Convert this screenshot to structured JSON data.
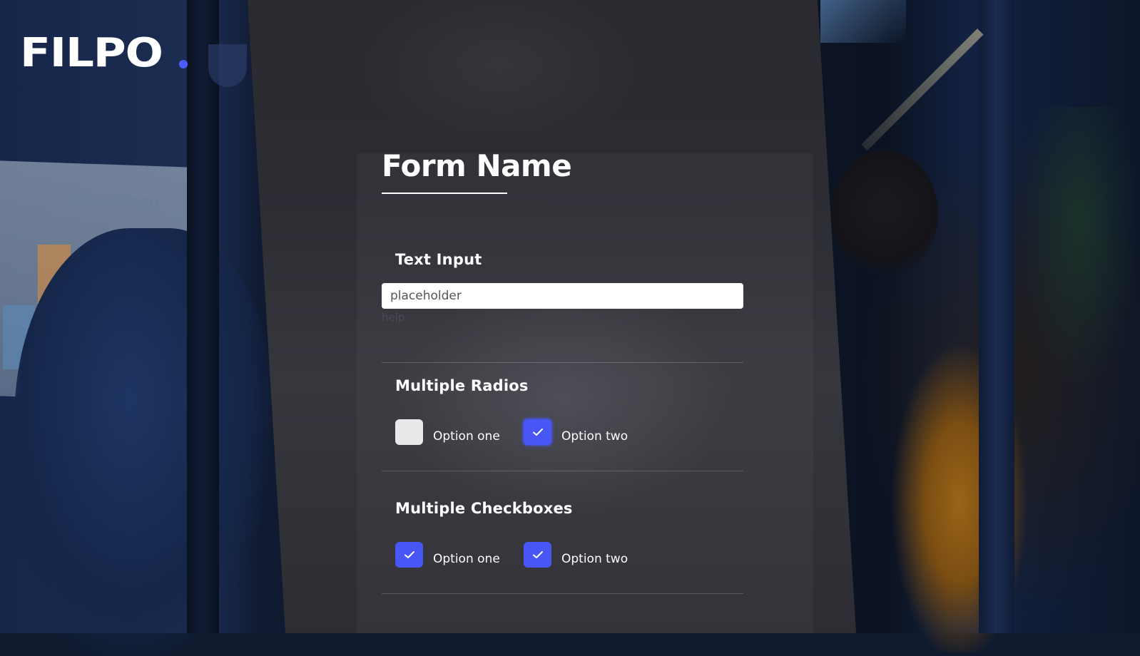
{
  "brand": {
    "logo_text": "FILPO",
    "accent_color": "#4b5bff"
  },
  "form": {
    "title": "Form Name",
    "text_input": {
      "label": "Text Input",
      "placeholder": "placeholder",
      "value": "",
      "help": "help"
    },
    "radios": {
      "label": "Multiple Radios",
      "options": [
        {
          "label": "Option one",
          "selected": false
        },
        {
          "label": "Option two",
          "selected": true
        }
      ]
    },
    "checkboxes": {
      "label": "Multiple Checkboxes",
      "options": [
        {
          "label": "Option one",
          "checked": true
        },
        {
          "label": "Option two",
          "checked": true
        }
      ]
    }
  },
  "colors": {
    "checked": "#4756f5",
    "unchecked": "#e9e9ec",
    "panel": "#2c2c33"
  },
  "icons": [
    "check-icon"
  ]
}
